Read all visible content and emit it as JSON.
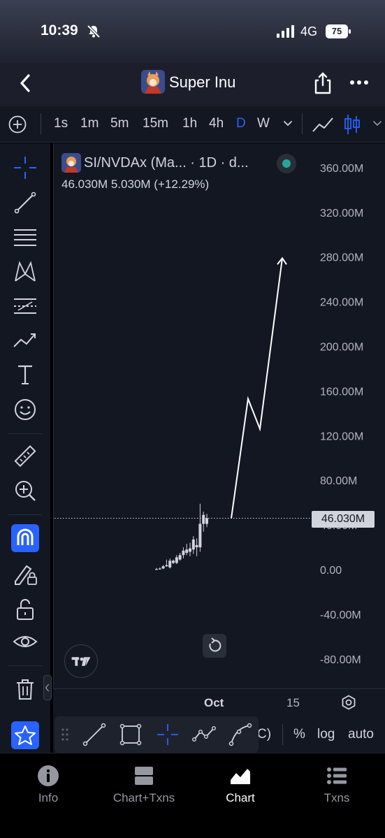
{
  "status_bar": {
    "time": "10:39",
    "network": "4G",
    "battery": "75"
  },
  "header": {
    "title": "Super Inu"
  },
  "timeframes": [
    {
      "label": "1s",
      "active": false
    },
    {
      "label": "1m",
      "active": false
    },
    {
      "label": "5m",
      "active": false
    },
    {
      "label": "15m",
      "active": false
    },
    {
      "label": "1h",
      "active": false
    },
    {
      "label": "4h",
      "active": false
    },
    {
      "label": "D",
      "active": true
    },
    {
      "label": "W",
      "active": false
    }
  ],
  "legend": {
    "title": "SI/NVDAx (Ma... · 1D · d...",
    "values": "46.030M  5.030M (+12.29%)"
  },
  "colors": {
    "accent": "#2962ff",
    "background": "#131722",
    "candle": "#d1d4dc",
    "status_dot": "#26a69a"
  },
  "chart_data": {
    "type": "candlestick",
    "y_ticks": [
      "360.00M",
      "320.00M",
      "280.00M",
      "240.00M",
      "200.00M",
      "160.00M",
      "120.00M",
      "80.00M",
      "40.00M",
      "0.00",
      "-40.00M",
      "-80.00M"
    ],
    "y_tick_values": [
      360,
      320,
      280,
      240,
      200,
      160,
      120,
      80,
      40,
      0,
      -40,
      -80
    ],
    "ylim": [
      -90,
      375
    ],
    "y_unit": "M",
    "x_ticks": [
      {
        "label": "Oct",
        "bold": true
      },
      {
        "label": "15",
        "bold": false
      }
    ],
    "last_price": 46.03,
    "last_price_label": "46.030M",
    "candles": [
      {
        "o": 0,
        "h": 1.5,
        "l": 0,
        "c": 0.5
      },
      {
        "o": 0.5,
        "h": 2,
        "l": 0,
        "c": 1
      },
      {
        "o": 1,
        "h": 4,
        "l": 0.5,
        "c": 3
      },
      {
        "o": 3,
        "h": 9,
        "l": 2.5,
        "c": 4
      },
      {
        "o": 2,
        "h": 10,
        "l": 1,
        "c": 8
      },
      {
        "o": 6,
        "h": 9,
        "l": 5,
        "c": 8
      },
      {
        "o": 6,
        "h": 13,
        "l": 5,
        "c": 11
      },
      {
        "o": 9,
        "h": 15,
        "l": 8,
        "c": 13
      },
      {
        "o": 13,
        "h": 20,
        "l": 10,
        "c": 17
      },
      {
        "o": 15,
        "h": 23,
        "l": 13,
        "c": 18
      },
      {
        "o": 16,
        "h": 24,
        "l": 12,
        "c": 19
      },
      {
        "o": 18,
        "h": 30,
        "l": 14,
        "c": 27
      },
      {
        "o": 20,
        "h": 28,
        "l": 12,
        "c": 22
      },
      {
        "o": 20,
        "h": 59,
        "l": 16,
        "c": 41
      },
      {
        "o": 41,
        "h": 52,
        "l": 34,
        "c": 49
      },
      {
        "o": 41,
        "h": 50,
        "l": 38,
        "c": 46.03
      }
    ],
    "drawn_arrow": [
      {
        "price": 46
      },
      {
        "price": 153
      },
      {
        "price": 126
      },
      {
        "price": 279
      }
    ]
  },
  "bottom_strip": {
    "tail": "C)",
    "percent": "%",
    "log": "log",
    "auto": "auto"
  },
  "tabs": [
    {
      "label": "Info",
      "active": false
    },
    {
      "label": "Chart+Txns",
      "active": false
    },
    {
      "label": "Chart",
      "active": true
    },
    {
      "label": "Txns",
      "active": false
    }
  ]
}
